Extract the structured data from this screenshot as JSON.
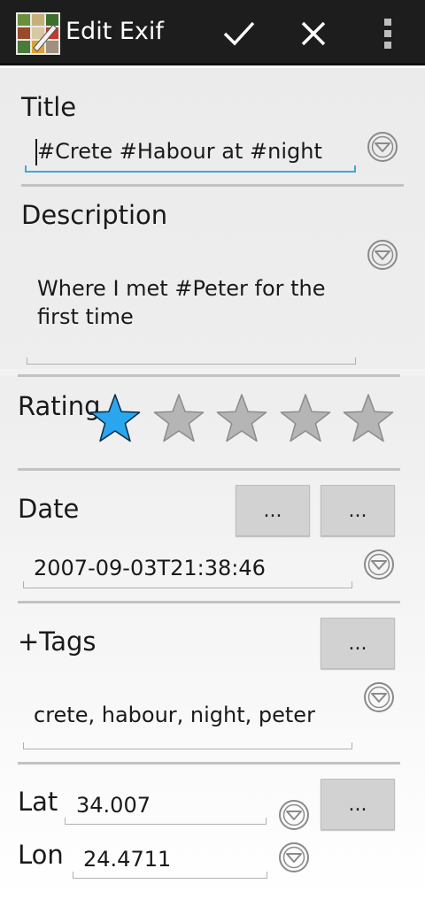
{
  "app": {
    "title": "Edit Exif",
    "icons": {
      "app": "photo-collage-icon",
      "confirm": "checkmark-icon",
      "cancel": "close-icon",
      "menu": "overflow-menu-icon"
    }
  },
  "colors": {
    "actionbar": "#1d1d1d",
    "accent": "#3fa8d8",
    "star_selected": "#2aa6ee",
    "star_empty": "#b5b5b5",
    "divider": "#c2c2c2"
  },
  "title": {
    "label": "Title",
    "value": "#Crete #Habour at #night"
  },
  "description": {
    "label": "Description",
    "value": "Where I met #Peter for the first time"
  },
  "rating": {
    "label": "Rating",
    "value": 1,
    "max": 5
  },
  "date": {
    "label": "Date",
    "value": "2007-09-03T21:38:46",
    "button1_label": "...",
    "button2_label": "..."
  },
  "tags": {
    "label": "+Tags",
    "value": "crete, habour, night, peter",
    "button_label": "..."
  },
  "geo": {
    "lat_label": "Lat",
    "lat_value": "34.007",
    "lon_label": "Lon",
    "lon_value": "24.4711",
    "button_label": "..."
  }
}
